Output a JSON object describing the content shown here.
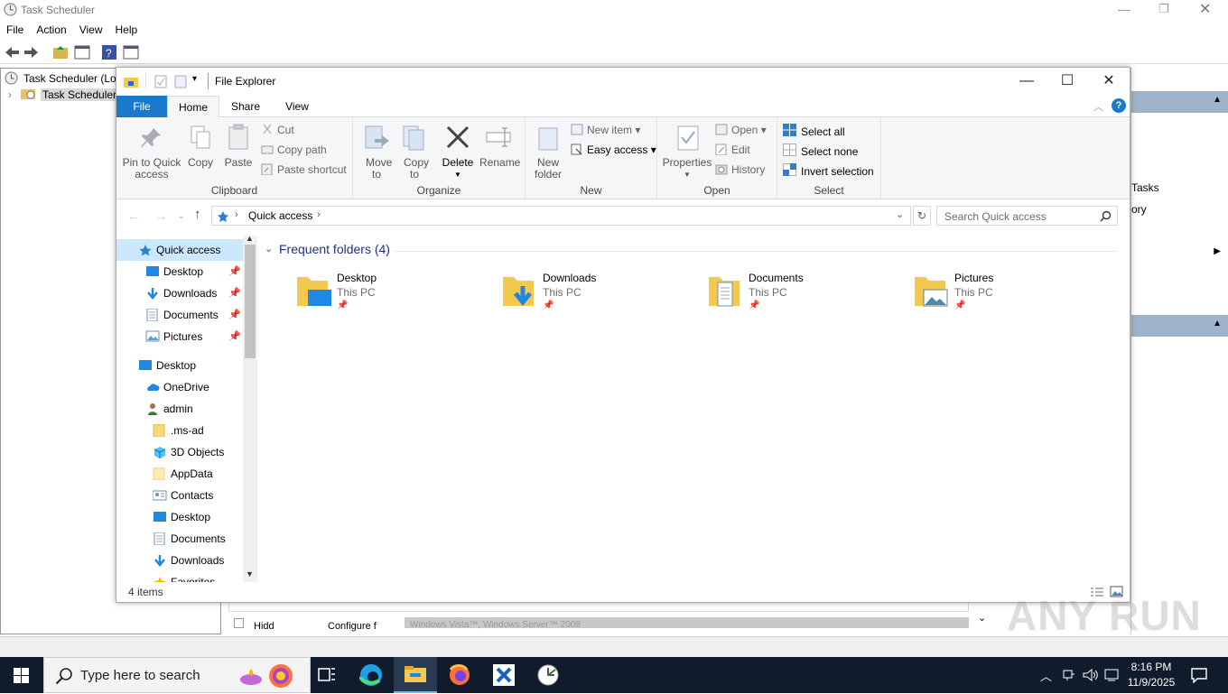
{
  "background_app": {
    "title": "Task Scheduler",
    "menu": [
      "File",
      "Action",
      "View",
      "Help"
    ],
    "tree": [
      "Task Scheduler (Loc",
      "Task Scheduler l"
    ],
    "right_fragments": [
      "Tasks",
      "ory"
    ],
    "bottom_rows": [
      "Hidd",
      "Configure f",
      "Windows Vista™, Windows Server™ 2008"
    ]
  },
  "explorer": {
    "title": "File Explorer",
    "tabs": {
      "file": "File",
      "home": "Home",
      "share": "Share",
      "view": "View"
    },
    "ribbon": {
      "clipboard": {
        "label": "Clipboard",
        "pin": "Pin to Quick access",
        "copy": "Copy",
        "paste": "Paste",
        "cut": "Cut",
        "copy_path": "Copy path",
        "paste_shortcut": "Paste shortcut"
      },
      "organize": {
        "label": "Organize",
        "move_to": "Move to",
        "copy_to": "Copy to",
        "delete": "Delete",
        "rename": "Rename"
      },
      "new": {
        "label": "New",
        "new_folder": "New folder",
        "new_item": "New item",
        "easy_access": "Easy access"
      },
      "open": {
        "label": "Open",
        "properties": "Properties",
        "open": "Open",
        "edit": "Edit",
        "history": "History"
      },
      "select": {
        "label": "Select",
        "select_all": "Select all",
        "select_none": "Select none",
        "invert": "Invert selection"
      }
    },
    "address": {
      "path": "Quick access",
      "search_placeholder": "Search Quick access"
    },
    "nav": [
      {
        "label": "Quick access",
        "icon": "star-icon",
        "selected": true
      },
      {
        "label": "Desktop",
        "icon": "desktop-icon",
        "pinned": true
      },
      {
        "label": "Downloads",
        "icon": "download-icon",
        "pinned": true
      },
      {
        "label": "Documents",
        "icon": "document-icon",
        "pinned": true
      },
      {
        "label": "Pictures",
        "icon": "pictures-icon",
        "pinned": true
      },
      {
        "label": "Desktop",
        "icon": "desktop-icon"
      },
      {
        "label": "OneDrive",
        "icon": "cloud-icon"
      },
      {
        "label": "admin",
        "icon": "user-icon"
      },
      {
        "label": ".ms-ad",
        "icon": "folder-icon"
      },
      {
        "label": "3D Objects",
        "icon": "cube-icon"
      },
      {
        "label": "AppData",
        "icon": "folder-icon"
      },
      {
        "label": "Contacts",
        "icon": "contacts-icon"
      },
      {
        "label": "Desktop",
        "icon": "desktop-icon"
      },
      {
        "label": "Documents",
        "icon": "document-icon"
      },
      {
        "label": "Downloads",
        "icon": "download-icon"
      },
      {
        "label": "Favorites",
        "icon": "star-icon"
      }
    ],
    "section_title": "Frequent folders (4)",
    "folders": [
      {
        "name": "Desktop",
        "location": "This PC",
        "icon": "desktop-folder-icon"
      },
      {
        "name": "Downloads",
        "location": "This PC",
        "icon": "downloads-folder-icon"
      },
      {
        "name": "Documents",
        "location": "This PC",
        "icon": "documents-folder-icon"
      },
      {
        "name": "Pictures",
        "location": "This PC",
        "icon": "pictures-folder-icon"
      }
    ],
    "status": "4 items"
  },
  "taskbar": {
    "search_placeholder": "Type here to search",
    "time": "8:16 PM",
    "date": "11/9/2025"
  },
  "watermark": "ANY RUN",
  "colors": {
    "accent": "#1979ca",
    "taskbar": "#101c2c",
    "selection": "#cce8ff",
    "link": "#1e3287"
  }
}
